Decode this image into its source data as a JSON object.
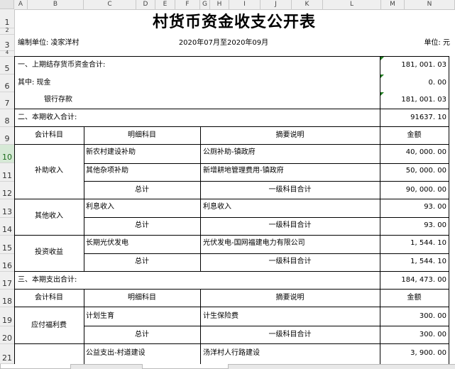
{
  "column_headers": [
    "A",
    "B",
    "C",
    "D",
    "E",
    "F",
    "G",
    "H",
    "I",
    "J",
    "K",
    "L",
    "M",
    "N"
  ],
  "row_headers": [
    "1",
    "2",
    "3",
    "4",
    "5",
    "6",
    "7",
    "8",
    "9",
    "10",
    "11",
    "12",
    "13",
    "14",
    "15",
    "16",
    "17",
    "18",
    "19",
    "20",
    "21"
  ],
  "sheet": {
    "title": "村货币资金收支公开表",
    "unit_org": "编制单位: 凌家洋村",
    "period": "2020年07月至2020年09月",
    "unit": "单位: 元",
    "prev_total_label": "一、上期结存货币资金合计:",
    "prev_total_value": "181, 001. 03",
    "cash_label": "其中: 现金",
    "cash_value": "0. 00",
    "bank_label": "银行存款",
    "bank_value": "181, 001. 03",
    "income_total_label": "二、本期收入合计:",
    "income_total_value": "91637. 10",
    "header_account": "会计科目",
    "header_detail": "明细科目",
    "header_desc": "摘要说明",
    "header_amount": "金额",
    "subsidy_group": "补助收入",
    "subsidy_row1_detail": "新农村建设补助",
    "subsidy_row1_desc": "公厕补助-镇政府",
    "subsidy_row1_amount": "40, 000. 00",
    "subsidy_row2_detail": "其他杂项补助",
    "subsidy_row2_desc": "新增耕地管理费用-镇政府",
    "subsidy_row2_amount": "50, 000. 00",
    "subsidy_total_label": "总计",
    "subsidy_total_desc": "一级科目合计",
    "subsidy_total_amount": "90, 000. 00",
    "other_group": "其他收入",
    "other_row1_detail": "利息收入",
    "other_row1_desc": "利息收入",
    "other_row1_amount": "93. 00",
    "other_total_label": "总计",
    "other_total_desc": "一级科目合计",
    "other_total_amount": "93. 00",
    "invest_group": "投资收益",
    "invest_row1_detail": "长期光伏发电",
    "invest_row1_desc": "光伏发电-国网福建电力有限公司",
    "invest_row1_amount": "1, 544. 10",
    "invest_total_label": "总计",
    "invest_total_desc": "一级科目合计",
    "invest_total_amount": "1, 544. 10",
    "expense_total_label": "三、本期支出合计:",
    "expense_total_value": "184, 473. 00",
    "welfare_group": "应付福利费",
    "welfare_row1_detail": "计划生育",
    "welfare_row1_desc": "计生保险费",
    "welfare_row1_amount": "300. 00",
    "welfare_total_label": "总计",
    "welfare_total_desc": "一级科目合计",
    "welfare_total_amount": "300. 00",
    "public_row1_detail": "公益支出-村道建设",
    "public_row1_desc": "汤洋村人行路建设",
    "public_row1_amount": "3, 900. 00"
  },
  "colors": {
    "header_bg": "#efefef",
    "selected_row": "#d6e9d6",
    "comment_marker": "#1e7b1e"
  }
}
